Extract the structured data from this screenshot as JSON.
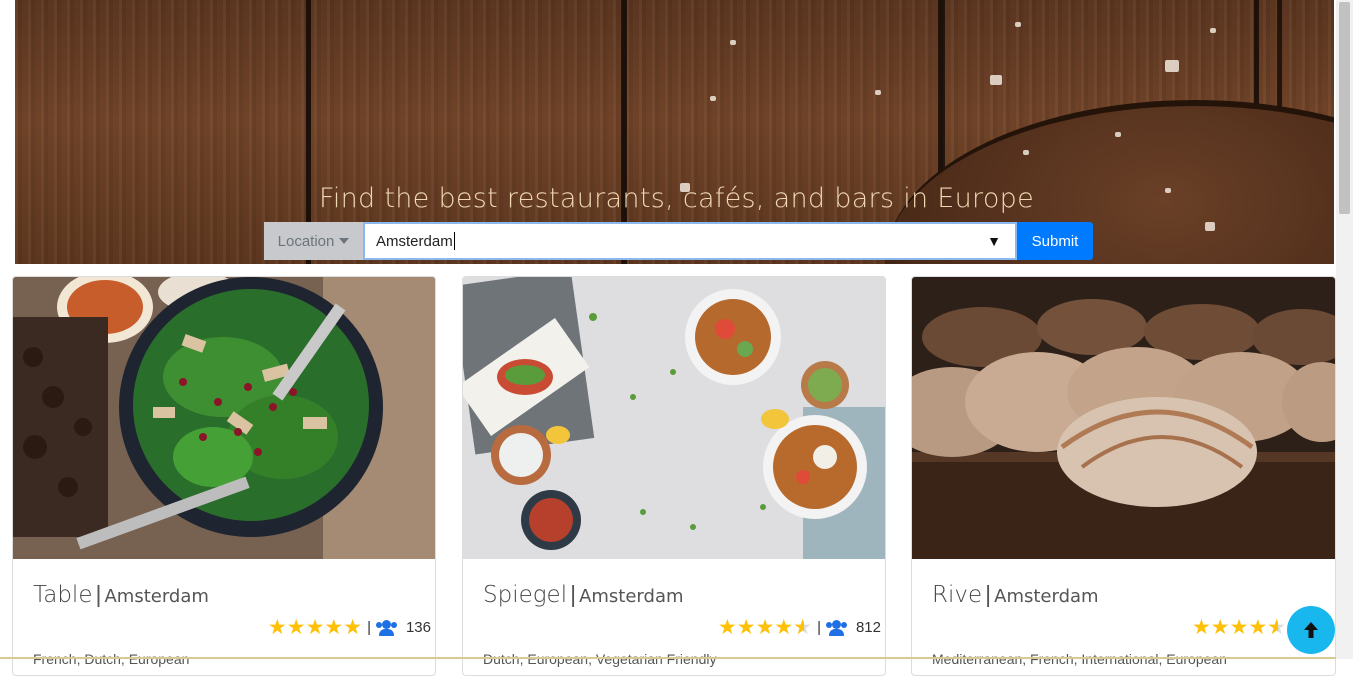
{
  "hero": {
    "title": "Find the best restaurants, cafés, and bars in Europe"
  },
  "search": {
    "location_label": "Location",
    "location_value": "Amsterdam",
    "dropdown_arrow": "▼",
    "submit_label": "Submit"
  },
  "cards": [
    {
      "name": "Table",
      "city": "Amsterdam",
      "rating": 5,
      "reviews": "136",
      "cuisines": "French, Dutch, European"
    },
    {
      "name": "Spiegel",
      "city": "Amsterdam",
      "rating": 4.5,
      "reviews": "812",
      "cuisines": "Dutch, European, Vegetarian Friendly"
    },
    {
      "name": "Rive",
      "city": "Amsterdam",
      "rating": 4.5,
      "reviews": "",
      "cuisines": "Mediterranean, French, International, European"
    }
  ],
  "back_to_top": {
    "icon": "arrow-up-icon",
    "glyph": "🡑"
  },
  "colors": {
    "accent": "#007bff",
    "star": "#ffc107",
    "users_icon": "#1f6fe5",
    "back_to_top": "#18b7ee"
  }
}
